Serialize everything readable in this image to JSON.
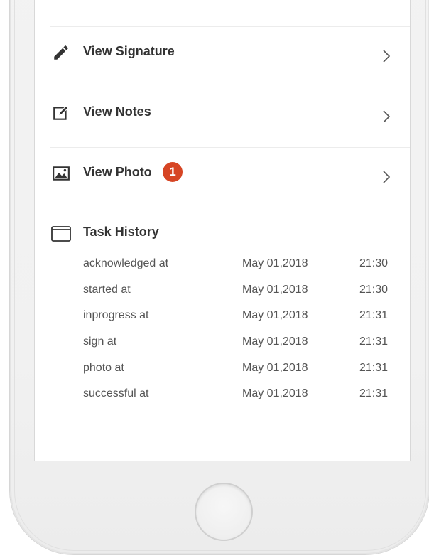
{
  "menu": {
    "items": [
      {
        "label": "View Signature",
        "icon": "pencil-icon"
      },
      {
        "label": "View Notes",
        "icon": "edit-note-icon"
      },
      {
        "label": "View Photo",
        "icon": "photo-icon",
        "badge": "1"
      }
    ]
  },
  "history": {
    "title": "Task History",
    "icon": "folder-icon",
    "rows": [
      {
        "event": "acknowledged at",
        "date": "May 01,2018",
        "time": "21:30"
      },
      {
        "event": "started at",
        "date": "May 01,2018",
        "time": "21:30"
      },
      {
        "event": "inprogress at",
        "date": "May 01,2018",
        "time": "21:31"
      },
      {
        "event": "sign at",
        "date": "May 01,2018",
        "time": "21:31"
      },
      {
        "event": "photo at",
        "date": "May 01,2018",
        "time": "21:31"
      },
      {
        "event": "successful at",
        "date": "May 01,2018",
        "time": "21:31"
      }
    ]
  },
  "colors": {
    "badge": "#d64524",
    "text_primary": "#333333",
    "text_secondary": "#555555",
    "divider": "#ececec"
  }
}
